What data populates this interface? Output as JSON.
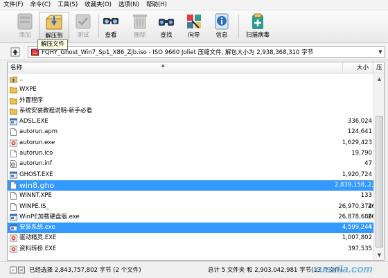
{
  "menu": [
    "文件(F)",
    "命令(C)",
    "工具(S)",
    "收藏夹(O)",
    "选项(N)",
    "帮助(H)"
  ],
  "toolbar": {
    "buttons": [
      {
        "label": "添加",
        "icon": "add-icon",
        "enabled": false
      },
      {
        "label": "解压到",
        "icon": "extract-to-icon",
        "enabled": true
      },
      {
        "label": "测试",
        "icon": "test-icon",
        "enabled": false
      },
      {
        "label": "查看",
        "icon": "view-icon",
        "enabled": true
      },
      {
        "label": "删除",
        "icon": "delete-icon",
        "enabled": false
      },
      {
        "label": "查找",
        "icon": "find-icon",
        "enabled": true
      },
      {
        "label": "向导",
        "icon": "wizard-icon",
        "enabled": true
      },
      {
        "label": "信息",
        "icon": "info-icon",
        "enabled": true
      },
      {
        "label": "扫描病毒",
        "icon": "virus-scan-icon",
        "enabled": true
      }
    ],
    "tooltip": "解压文件"
  },
  "path": {
    "text": "FQHY_Ghost_Win7_Sp1_X86_Zjb.iso - ISO 9660 Joliet 压缩文件, 解包大小为 2,938,368,310 字节"
  },
  "columns": {
    "name": "名称",
    "size": "大小",
    "packed": "压"
  },
  "rows": [
    {
      "name": "..",
      "size": "",
      "type": "up"
    },
    {
      "name": "WXPE",
      "size": "",
      "type": "folder"
    },
    {
      "name": "外置程序",
      "size": "",
      "type": "folder"
    },
    {
      "name": "系统安装教程说明-新手必看",
      "size": "",
      "type": "folder"
    },
    {
      "name": "ADSL.EXE",
      "size": "336,024",
      "type": "exe"
    },
    {
      "name": "autorun.apm",
      "size": "124,641",
      "type": "file"
    },
    {
      "name": "autorun.exe",
      "size": "1,629,423",
      "type": "exe-red"
    },
    {
      "name": "autorun.ico",
      "size": "19,790",
      "type": "file"
    },
    {
      "name": "autorun.inf",
      "size": "47",
      "type": "gear"
    },
    {
      "name": "GHOST.EXE",
      "size": "1,920,724",
      "type": "exe"
    },
    {
      "name": "win8.gho",
      "size": "2,839,158,...",
      "packed": "2,8",
      "type": "file",
      "state": "highlight"
    },
    {
      "name": "WINNT.XPE",
      "size": "133",
      "type": "file"
    },
    {
      "name": "WINPE.IS_",
      "size": "26,970,374",
      "packed": "26",
      "type": "file"
    },
    {
      "name": "WinPE加载硬盘版.exe",
      "size": "26,878,686",
      "packed": "26",
      "type": "exe"
    },
    {
      "name": "安装系统.exe",
      "size": "4,599,244",
      "packed": "4",
      "type": "exe",
      "state": "selected"
    },
    {
      "name": "驱动精灵.EXE",
      "size": "1,007,802",
      "type": "exe-red"
    },
    {
      "name": "资料转移.EXE",
      "size": "397,535",
      "type": "exe-red"
    }
  ],
  "status": {
    "left": "已经选择 2,843,757,802 字节 (2 个文件)",
    "right": "总计 5 文件夹 和 2,903,042,981 字节(13 个文件)",
    "watermark": "xuexila.com"
  },
  "colors": {
    "selection": "#3399ff",
    "folder": "#f2c14e"
  }
}
